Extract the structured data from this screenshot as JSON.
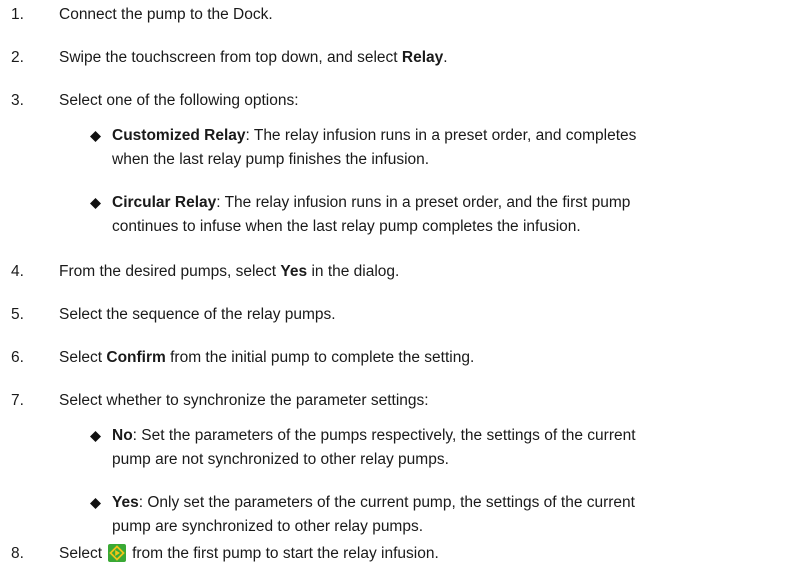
{
  "steps": [
    {
      "num": "1.",
      "pre": "Connect the pump to the Dock.",
      "bold": "",
      "post": ""
    },
    {
      "num": "2.",
      "pre": "Swipe the touchscreen from top down, and select ",
      "bold": "Relay",
      "post": "."
    },
    {
      "num": "3.",
      "pre": "Select one of the following options:",
      "bold": "",
      "post": ""
    },
    {
      "num": "4.",
      "pre": "From the desired pumps, select ",
      "bold": "Yes",
      "post": " in the dialog."
    },
    {
      "num": "5.",
      "pre": "Select the sequence of the relay pumps.",
      "bold": "",
      "post": ""
    },
    {
      "num": "6.",
      "pre": "Select ",
      "bold": "Confirm",
      "post": " from the initial pump to complete the setting."
    },
    {
      "num": "7.",
      "pre": "Select whether to synchronize the parameter settings:",
      "bold": "",
      "post": ""
    },
    {
      "num": "8.",
      "pre": "Select",
      "bold": "",
      "post": "from the first pump to start the relay infusion."
    }
  ],
  "step3_options": [
    {
      "bold": "Customized Relay",
      "line1": ": The relay infusion runs in a preset order, and completes",
      "line2": "when the last relay pump finishes the infusion."
    },
    {
      "bold": "Circular Relay",
      "line1": ": The relay infusion runs in a preset order, and the first pump",
      "line2": "continues to infuse when the last relay pump completes the infusion."
    }
  ],
  "step7_options": [
    {
      "bold": "No",
      "line1": ": Set the parameters of the pumps respectively, the settings of the current",
      "line2": "pump are not synchronized to other relay pumps."
    },
    {
      "bold": "Yes",
      "line1": ": Only set the parameters of the current pump, the settings of the current",
      "line2": "pump are synchronized to other relay pumps."
    }
  ],
  "icons": {
    "bullet": "diamond-bullet-icon",
    "start": "start-infusion-icon"
  },
  "colors": {
    "start_icon_bg": "#3aa935",
    "start_icon_fg": "#f0c419",
    "text": "#1a1a1a"
  }
}
